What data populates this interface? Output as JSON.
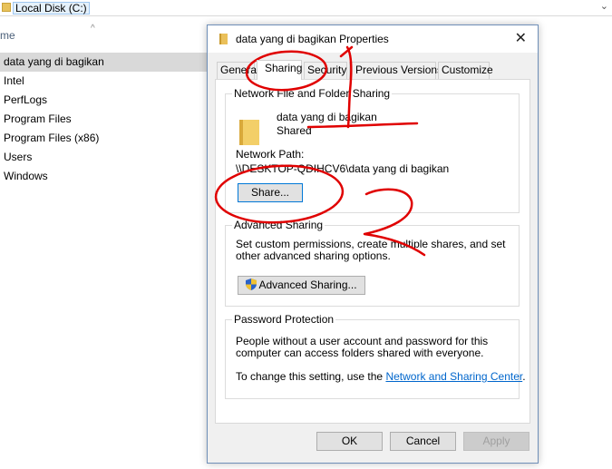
{
  "explorer": {
    "address": "Local Disk (C:)",
    "column_header": "me",
    "items": [
      {
        "label": "data yang di bagikan",
        "selected": true
      },
      {
        "label": "Intel"
      },
      {
        "label": "PerfLogs"
      },
      {
        "label": "Program Files"
      },
      {
        "label": "Program Files (x86)"
      },
      {
        "label": "Users"
      },
      {
        "label": "Windows"
      }
    ]
  },
  "dialog": {
    "title": "data yang di bagikan Properties",
    "tabs": [
      "General",
      "Sharing",
      "Security",
      "Previous Versions",
      "Customize"
    ],
    "active_tab": "Sharing",
    "network_sharing": {
      "legend": "Network File and Folder Sharing",
      "folder_name": "data yang di bagikan",
      "status": "Shared",
      "path_label": "Network Path:",
      "path_value": "\\\\DESKTOP-QDIHCV6\\data yang di bagikan",
      "share_button": "Share..."
    },
    "advanced_sharing": {
      "legend": "Advanced Sharing",
      "description": "Set custom permissions, create multiple shares, and set other advanced sharing options.",
      "button": "Advanced Sharing..."
    },
    "password_protection": {
      "legend": "Password Protection",
      "description": "People without a user account and password for this computer can access folders shared with everyone.",
      "change_text": "To change this setting, use the ",
      "link": "Network and Sharing Center",
      "suffix": "."
    },
    "buttons": {
      "ok": "OK",
      "cancel": "Cancel",
      "apply": "Apply"
    }
  },
  "colors": {
    "annotation": "#e00000",
    "link": "#0066cc",
    "selection": "#d9d9d9",
    "dialog_bg": "#f0f0f0"
  },
  "annotations": [
    "1",
    "2"
  ]
}
